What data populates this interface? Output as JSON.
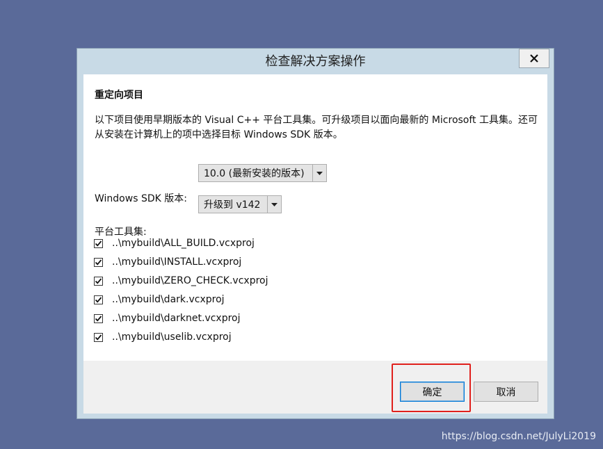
{
  "dialog": {
    "title": "检查解决方案操作",
    "close_label": "X"
  },
  "section": {
    "title": "重定向项目",
    "description": "以下项目使用早期版本的 Visual C++ 平台工具集。可升级项目以面向最新的 Microsoft 工具集。还可从安装在计算机上的项中选择目标 Windows SDK 版本。"
  },
  "sdk": {
    "label": "Windows SDK 版本:",
    "value": "10.0 (最新安装的版本)"
  },
  "toolset": {
    "label": "平台工具集:",
    "value": "升级到 v142"
  },
  "projects": [
    {
      "name": "..\\mybuild\\ALL_BUILD.vcxproj",
      "checked": true
    },
    {
      "name": "..\\mybuild\\INSTALL.vcxproj",
      "checked": true
    },
    {
      "name": "..\\mybuild\\ZERO_CHECK.vcxproj",
      "checked": true
    },
    {
      "name": "..\\mybuild\\dark.vcxproj",
      "checked": true
    },
    {
      "name": "..\\mybuild\\darknet.vcxproj",
      "checked": true
    },
    {
      "name": "..\\mybuild\\uselib.vcxproj",
      "checked": true
    }
  ],
  "buttons": {
    "ok_label": "确定",
    "cancel_label": "取消"
  },
  "watermark": "https://blog.csdn.net/JulyLi2019",
  "colors": {
    "desktop": "#5a6a99",
    "dialog_frame": "#c8dae6",
    "highlight": "#e0201c"
  }
}
